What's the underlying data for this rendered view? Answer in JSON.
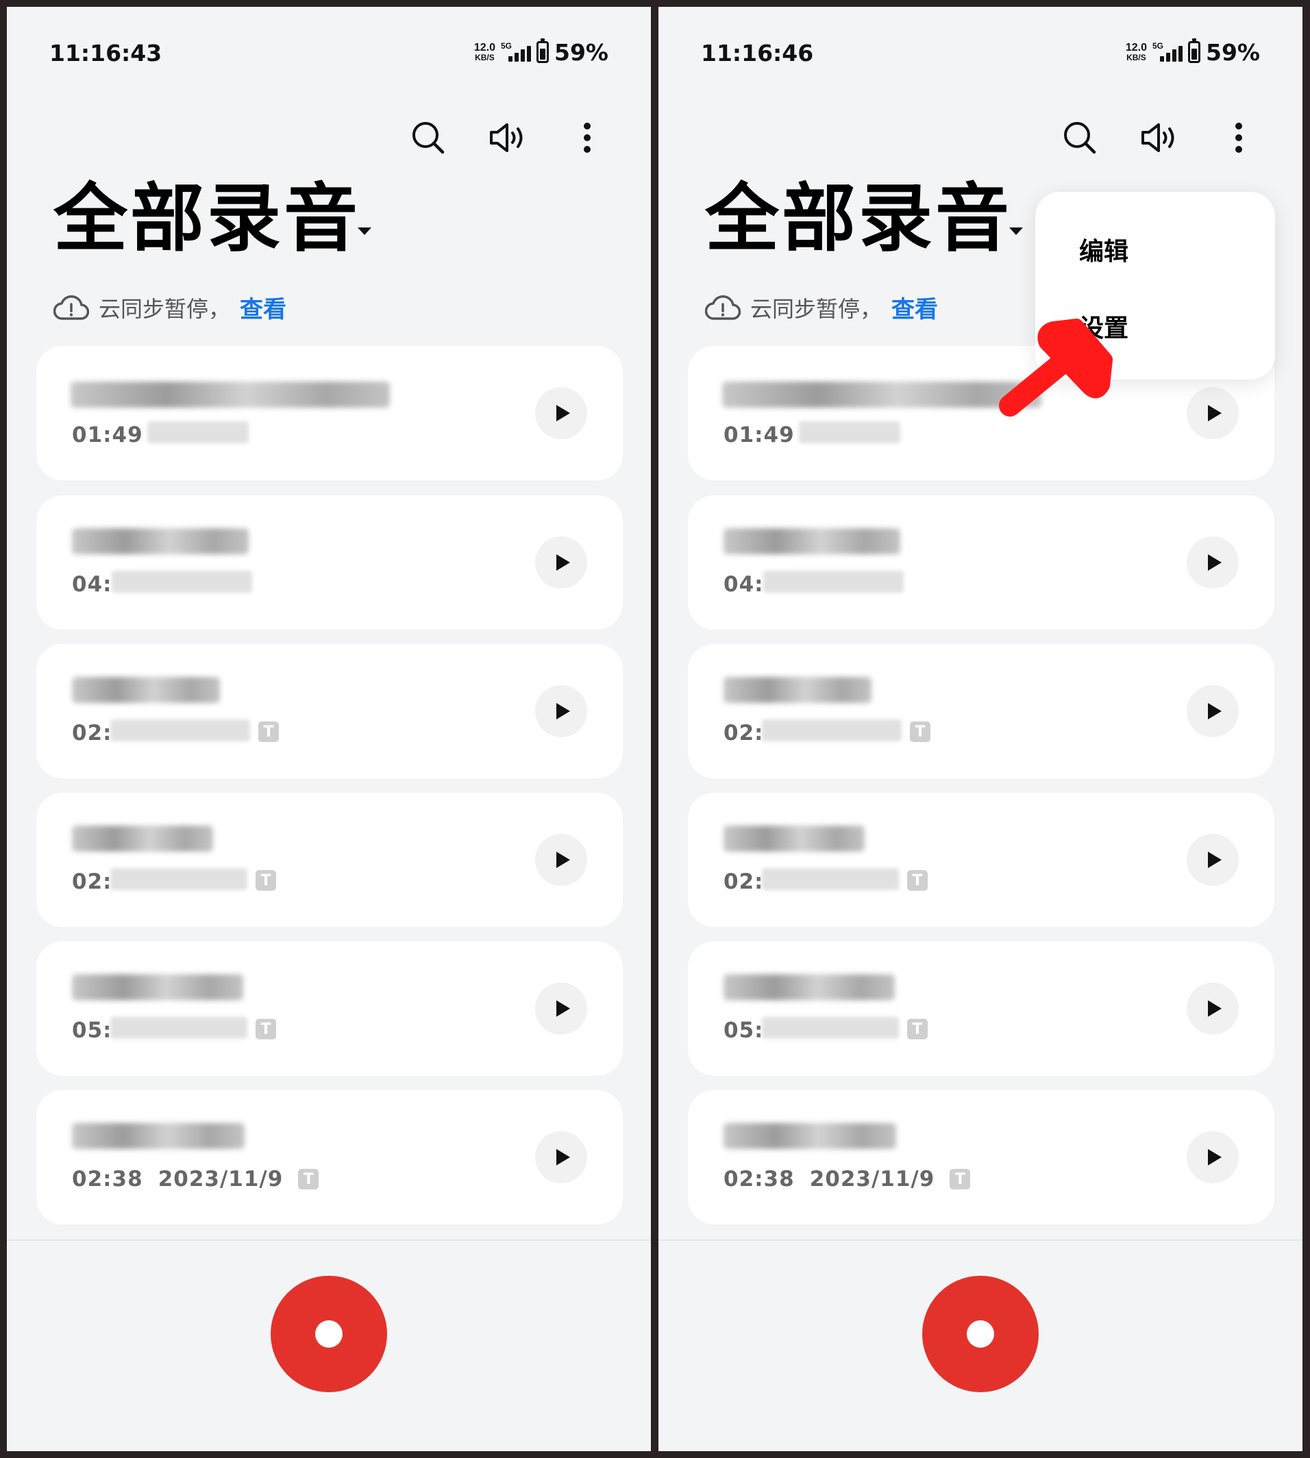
{
  "colors": {
    "accent": "#1576e8",
    "record": "#e3322b",
    "annotation": "#ff1a1a"
  },
  "screens": [
    {
      "status": {
        "time": "11:16:43",
        "net_speed": "12.0",
        "net_unit": "KB/S",
        "network": "5G",
        "battery": "59%"
      }
    },
    {
      "status": {
        "time": "11:16:46",
        "net_speed": "12.0",
        "net_unit": "KB/S",
        "network": "5G",
        "battery": "59%"
      },
      "menu": {
        "items": [
          "编辑",
          "设置"
        ]
      }
    }
  ],
  "header": {
    "title": "全部录音",
    "sync_text": "云同步暂停，",
    "sync_link": "查看",
    "icons": [
      "search-icon",
      "speaker-icon",
      "more-icon"
    ]
  },
  "recordings": [
    {
      "duration": "01:49",
      "date": "",
      "has_transcript": false
    },
    {
      "duration": "04:",
      "date": "",
      "has_transcript": false
    },
    {
      "duration": "02:",
      "date": "",
      "has_transcript": true
    },
    {
      "duration": "02:",
      "date": "",
      "has_transcript": true
    },
    {
      "duration": "05:",
      "date": "",
      "has_transcript": true
    },
    {
      "duration": "02:38",
      "date": "2023/11/9",
      "has_transcript": true
    }
  ],
  "transcript_badge": "T"
}
